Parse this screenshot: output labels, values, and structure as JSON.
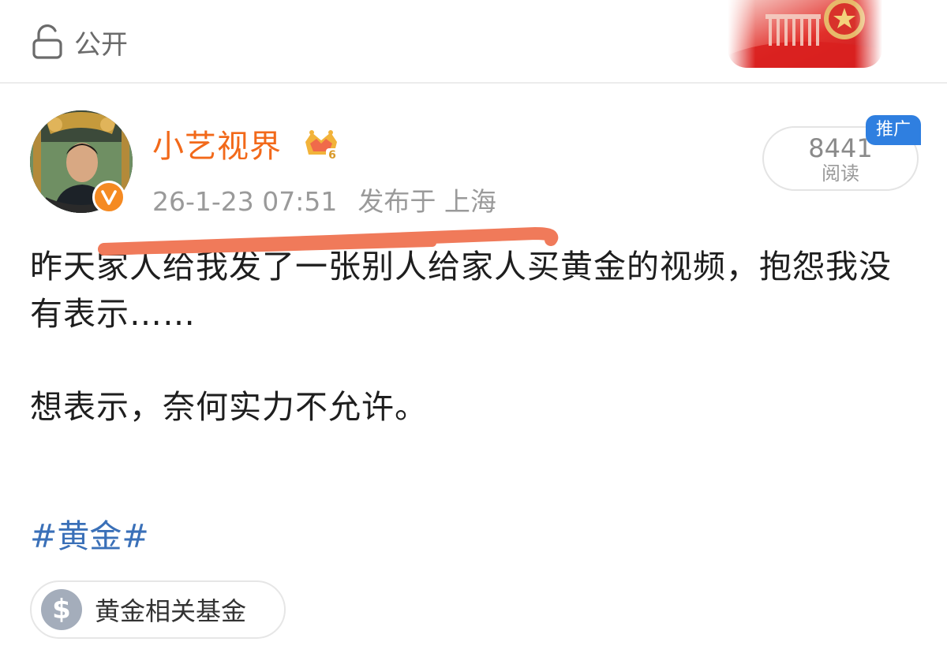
{
  "topbar": {
    "visibility_label": "公开",
    "visibility_icon": "lock-open-icon",
    "banner_icon": "national-emblem-banner"
  },
  "post": {
    "author": {
      "name": "小艺视界",
      "name_color": "#f2691a",
      "avatar": "avatar-photo",
      "verified_icon": "verified-v-icon",
      "level_badge": "crown-badge-icon",
      "level_badge_number": "6"
    },
    "timestamp": "26-1-23 07:51",
    "location": "发布于 上海",
    "reads": {
      "count": "8441",
      "label": "阅读",
      "tag": "推广",
      "tag_color": "#2f7fe0"
    },
    "body": {
      "paragraph_1": "昨天家人给我发了一张别人给家人买黄金的视频，抱怨我没有表示……",
      "paragraph_2": "想表示，奈何实力不允许。"
    },
    "hashtag": "#黄金#",
    "hashtag_color": "#3a70b8",
    "fund_chip": {
      "icon": "dollar-icon",
      "symbol": "$",
      "label": "黄金相关基金"
    }
  }
}
